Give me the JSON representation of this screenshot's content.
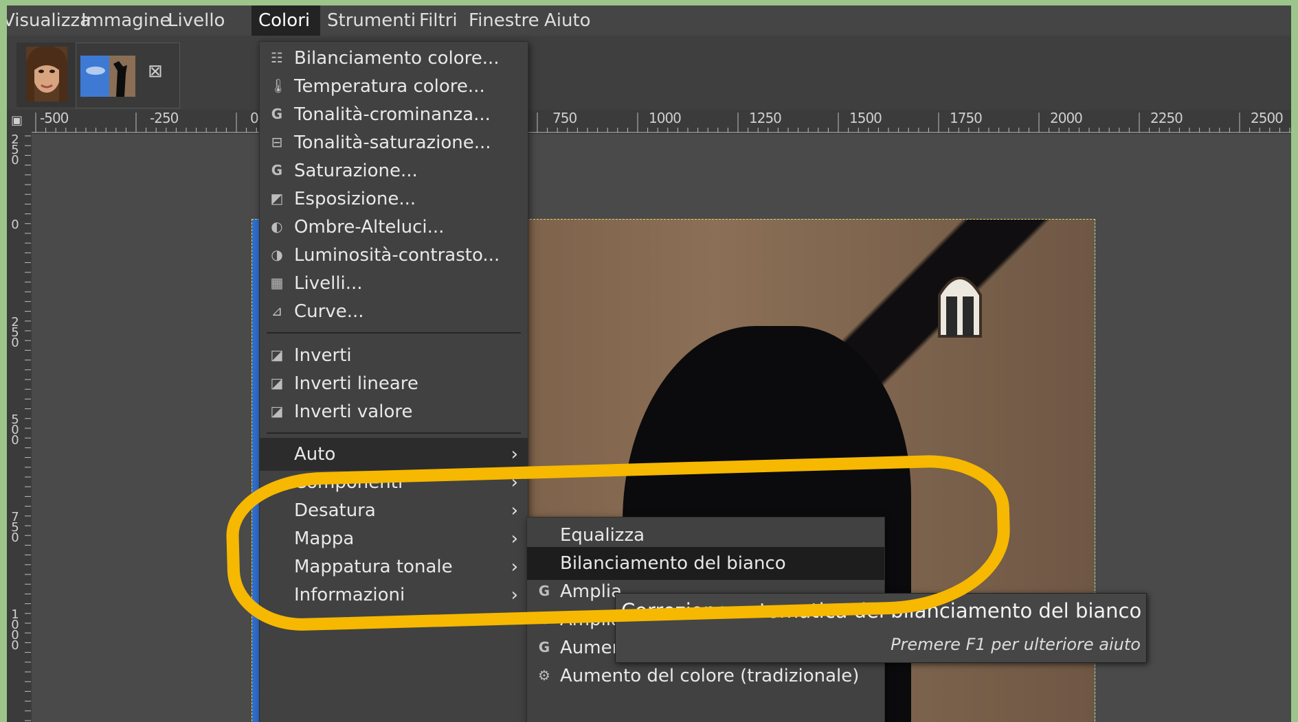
{
  "menubar": {
    "items": [
      "Visualizza",
      "Immagine",
      "Livello",
      "Colori",
      "Strumenti",
      "Filtri",
      "Finestre",
      "Aiuto"
    ],
    "active": "Colori"
  },
  "ruler": {
    "horizontal": [
      "-500",
      "-250",
      "0",
      "750",
      "1000",
      "1250",
      "1500",
      "1750",
      "2000",
      "2250",
      "2500"
    ],
    "vertical": [
      "250",
      "0",
      "250",
      "500",
      "750",
      "1000"
    ]
  },
  "colori_menu": {
    "items": [
      {
        "label": "Bilanciamento colore...",
        "icon": "color-balance-icon"
      },
      {
        "label": "Temperatura colore...",
        "icon": "color-temperature-icon"
      },
      {
        "label": "Tonalità-crominanza...",
        "icon": "gegl-icon"
      },
      {
        "label": "Tonalità-saturazione...",
        "icon": "hue-saturation-icon"
      },
      {
        "label": "Saturazione...",
        "icon": "gegl-icon"
      },
      {
        "label": "Esposizione...",
        "icon": "exposure-icon"
      },
      {
        "label": "Ombre-Alteluci...",
        "icon": "shadows-highlights-icon"
      },
      {
        "label": "Luminosità-contrasto...",
        "icon": "brightness-contrast-icon"
      },
      {
        "label": "Livelli...",
        "icon": "levels-icon"
      },
      {
        "label": "Curve...",
        "icon": "curves-icon"
      },
      {
        "label": "Inverti",
        "icon": "invert-icon"
      },
      {
        "label": "Inverti lineare",
        "icon": "invert-icon"
      },
      {
        "label": "Inverti valore",
        "icon": "invert-icon"
      },
      {
        "label": "Auto"
      },
      {
        "label": "Componenti"
      },
      {
        "label": "Desatura"
      },
      {
        "label": "Mappa"
      },
      {
        "label": "Mappatura tonale"
      },
      {
        "label": "Informazioni"
      }
    ]
  },
  "auto_menu": {
    "items": [
      {
        "label": "Equalizza"
      },
      {
        "label": "Bilanciamento del bianco"
      },
      {
        "label": "Amplia",
        "icon": "gegl-icon"
      },
      {
        "label": "Amplia",
        "icon": "gegl-icon"
      },
      {
        "label": "Aumento colore",
        "icon": "gegl-icon"
      },
      {
        "label": "Aumento del colore (tradizionale)",
        "icon": "plugin-icon"
      }
    ]
  },
  "tooltip": {
    "title": "Correzione automatica del bilanciamento del bianco",
    "hint": "Premere F1 per ulteriore aiuto"
  },
  "colors": {
    "highlight": "#f6b800",
    "frame": "#9cc58c"
  }
}
